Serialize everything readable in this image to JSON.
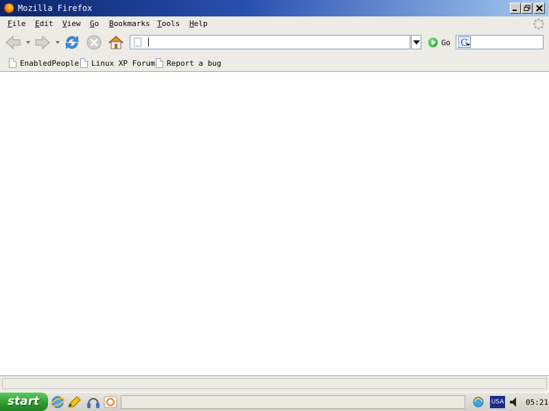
{
  "window": {
    "title": "Mozilla Firefox"
  },
  "menu": {
    "items": [
      {
        "label": "File",
        "accel": "F",
        "rest": "ile"
      },
      {
        "label": "Edit",
        "accel": "E",
        "rest": "dit"
      },
      {
        "label": "View",
        "accel": "V",
        "rest": "iew"
      },
      {
        "label": "Go",
        "accel": "G",
        "rest": "o"
      },
      {
        "label": "Bookmarks",
        "accel": "B",
        "rest": "ookmarks"
      },
      {
        "label": "Tools",
        "accel": "T",
        "rest": "ools"
      },
      {
        "label": "Help",
        "accel": "H",
        "rest": "elp"
      }
    ]
  },
  "toolbar": {
    "url_value": "",
    "go_label": "Go",
    "search_value": ""
  },
  "bookmarks": [
    {
      "label": "EnabledPeople"
    },
    {
      "label": "Linux XP Forum"
    },
    {
      "label": "Report a bug"
    }
  ],
  "statusbar": {
    "text": ""
  },
  "taskbar": {
    "start_label": "start",
    "tray_language": "USA",
    "clock": "05:21"
  },
  "colors": {
    "titlebar_dark": "#0a246a",
    "titlebar_light": "#a6caf0",
    "chrome": "#ecebe6",
    "start_green": "#2e9b2e"
  }
}
